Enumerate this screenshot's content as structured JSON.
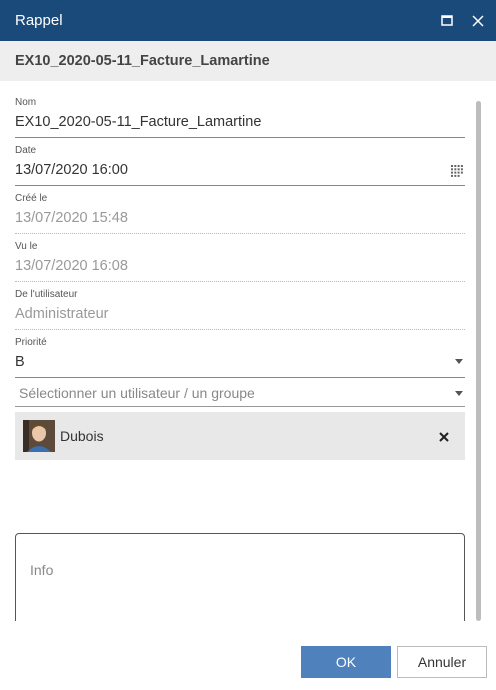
{
  "window": {
    "title": "Rappel",
    "maximize_icon": "maximize-icon",
    "close_icon": "close-icon"
  },
  "document": {
    "title": "EX10_2020-05-11_Facture_Lamartine"
  },
  "form": {
    "name": {
      "label": "Nom",
      "value": "EX10_2020-05-11_Facture_Lamartine"
    },
    "date": {
      "label": "Date",
      "value": "13/07/2020 16:00",
      "icon": "calendar-icon"
    },
    "created": {
      "label": "Créé le",
      "value": "13/07/2020 15:48"
    },
    "seen": {
      "label": "Vu le",
      "value": "13/07/2020 16:08"
    },
    "from_user": {
      "label": "De l'utilisateur",
      "value": "Administrateur"
    },
    "priority": {
      "label": "Priorité",
      "value": "B"
    },
    "assignee_select": {
      "placeholder": "Sélectionner un utilisateur / un groupe"
    },
    "assignees": [
      {
        "name": "Dubois"
      }
    ],
    "info": {
      "placeholder": "Info"
    }
  },
  "buttons": {
    "ok": "OK",
    "cancel": "Annuler"
  },
  "colors": {
    "titlebar": "#1a4a7a",
    "primary_button": "#4f81bd",
    "chip_bg": "#e8e8e8",
    "subheader_bg": "#eeeeee"
  }
}
